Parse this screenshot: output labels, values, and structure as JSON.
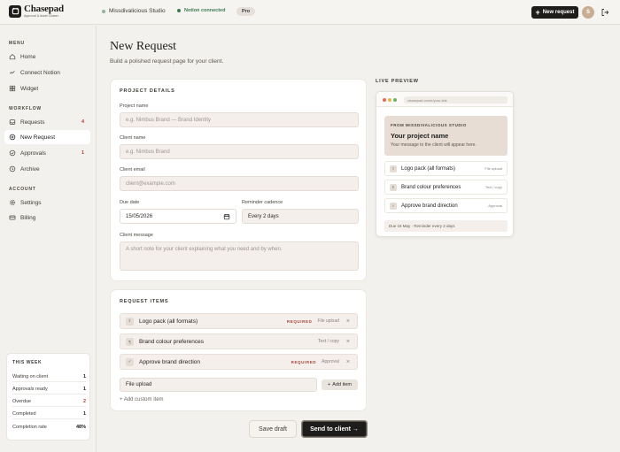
{
  "app": {
    "name": "Chasepad",
    "tagline": "Approval & Asset Chaser",
    "studio": "Missdivalicious Studio",
    "notion_status": "Notion connected",
    "plan": "Pro",
    "new_request_label": "New request",
    "avatar_initial": "S"
  },
  "sidebar": {
    "menu_label": "MENU",
    "workflow_label": "WORKFLOW",
    "account_label": "ACCOUNT",
    "menu_items": [
      {
        "label": "Home",
        "icon": "home-icon"
      },
      {
        "label": "Connect Notion",
        "icon": "link-icon"
      },
      {
        "label": "Widget",
        "icon": "grid-icon"
      }
    ],
    "workflow_items": [
      {
        "label": "Requests",
        "icon": "inbox-icon",
        "badge": "4"
      },
      {
        "label": "New Request",
        "icon": "plus-circle-icon",
        "active": true
      },
      {
        "label": "Approvals",
        "icon": "check-circle-icon",
        "badge": "1"
      },
      {
        "label": "Archive",
        "icon": "clock-icon"
      }
    ],
    "account_items": [
      {
        "label": "Settings",
        "icon": "gear-icon"
      },
      {
        "label": "Billing",
        "icon": "card-icon"
      }
    ],
    "this_week": {
      "title": "THIS WEEK",
      "rows": [
        {
          "label": "Waiting on client",
          "value": "1"
        },
        {
          "label": "Approvals ready",
          "value": "1"
        },
        {
          "label": "Overdue",
          "value": "2",
          "alert": true
        },
        {
          "label": "Completed",
          "value": "1"
        },
        {
          "label": "Completion rate",
          "value": "48%"
        }
      ]
    }
  },
  "main": {
    "title": "New Request",
    "subtitle": "Build a polished request page for your client.",
    "details": {
      "title": "PROJECT DETAILS",
      "project_name_label": "Project name",
      "project_name_placeholder": "e.g. Nimbus Brand — Brand Identity",
      "client_name_label": "Client name",
      "client_name_placeholder": "e.g. Nimbus Brand",
      "client_email_label": "Client email",
      "client_email_placeholder": "client@example.com",
      "due_date_label": "Due date",
      "due_date_value": "15/05/2026",
      "reminder_label": "Reminder cadence",
      "reminder_value": "Every 2 days",
      "message_label": "Client message",
      "message_placeholder": "A short note for your client explaining what you need and by when."
    },
    "items": {
      "title": "REQUEST ITEMS",
      "list": [
        {
          "name": "Logo pack (all formats)",
          "required": "REQUIRED",
          "type": "File upload",
          "icon": "upload-icon"
        },
        {
          "name": "Brand colour preferences",
          "required": "",
          "type": "Text / copy",
          "icon": "text-icon"
        },
        {
          "name": "Approve brand direction",
          "required": "REQUIRED",
          "type": "Approval",
          "icon": "check-icon"
        }
      ],
      "type_select": "File upload",
      "add_item_label": "Add item",
      "add_custom_label": "+ Add custom item"
    },
    "save_draft_label": "Save draft",
    "send_label": "Send to client →"
  },
  "preview": {
    "label": "LIVE PREVIEW",
    "url": "chasepad.com/r/your-link",
    "from": "FROM MISSDIVALICIOUS STUDIO",
    "project_title": "Your project name",
    "message": "Your message to the client will appear here.",
    "items": [
      {
        "name": "Logo pack (all formats)",
        "type": "File upload"
      },
      {
        "name": "Brand colour preferences",
        "type": "Text / copy"
      },
      {
        "name": "Approve brand direction",
        "type": "Approval"
      }
    ],
    "footer": "Due 15 May · Reminder every 2 days"
  },
  "colors": {
    "accent_dark": "#1e1d1b",
    "alert_red": "#c0392b",
    "connected_green": "#3f7a55"
  }
}
